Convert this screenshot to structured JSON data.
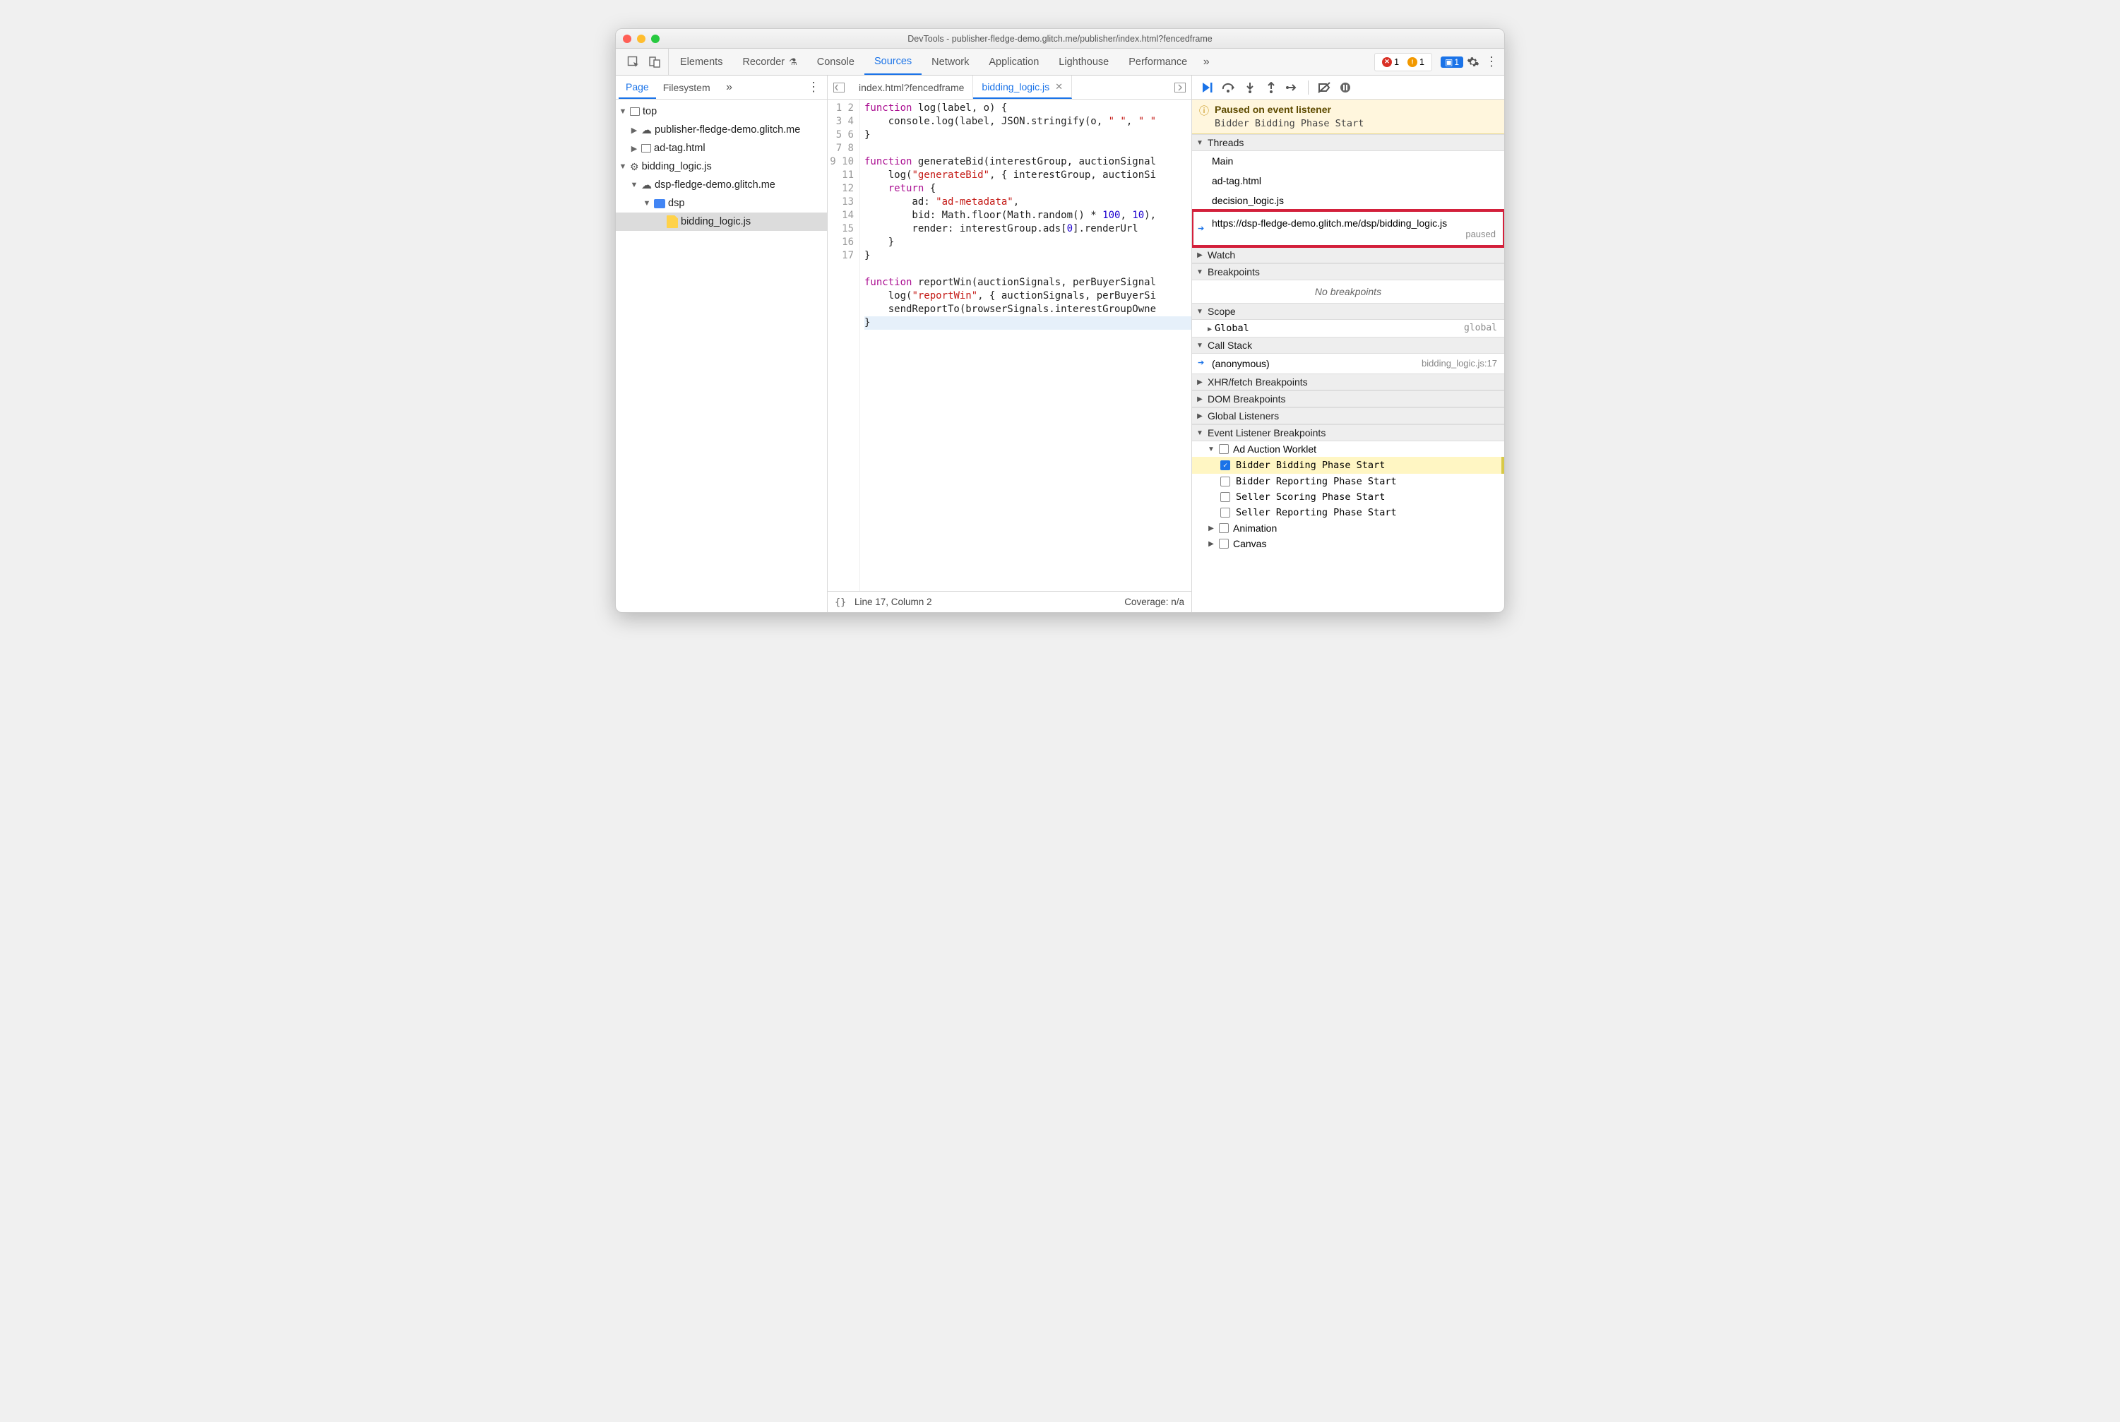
{
  "window": {
    "title": "DevTools - publisher-fledge-demo.glitch.me/publisher/index.html?fencedframe"
  },
  "topTabs": {
    "items": [
      "Elements",
      "Recorder",
      "Console",
      "Sources",
      "Network",
      "Application",
      "Lighthouse",
      "Performance"
    ],
    "active": "Sources"
  },
  "badges": {
    "errors": "1",
    "warnings": "1",
    "issues": "1"
  },
  "leftTabs": {
    "items": [
      "Page",
      "Filesystem"
    ],
    "active": "Page"
  },
  "tree": {
    "top": "top",
    "pub": "publisher-fledge-demo.glitch.me",
    "adtag": "ad-tag.html",
    "worklet": "bidding_logic.js",
    "dsphost": "dsp-fledge-demo.glitch.me",
    "dspfolder": "dsp",
    "dspfile": "bidding_logic.js"
  },
  "centerTabs": {
    "items": [
      "index.html?fencedframe",
      "bidding_logic.js"
    ],
    "active": "bidding_logic.js"
  },
  "code": {
    "lines": 17,
    "l1_a": "function",
    "l1_b": " log(label, o) {",
    "l2": "    console.log(label, JSON.stringify(o, ",
    "l2s": "\" \"",
    "l2m": ", ",
    "l2s2": "\" \"",
    "l3": "}",
    "l4": "",
    "l5_a": "function",
    "l5_b": " generateBid(interestGroup, auctionSignal",
    "l6_a": "    log(",
    "l6_s": "\"generateBid\"",
    "l6_b": ", { interestGroup, auctionSi",
    "l7_a": "    ",
    "l7_k": "return",
    "l7_b": " {",
    "l8_a": "        ad: ",
    "l8_s": "\"ad-metadata\"",
    "l8_b": ",",
    "l9_a": "        bid: Math.floor(Math.random() * ",
    "l9_n1": "100",
    "l9_m": ", ",
    "l9_n2": "10",
    "l9_b": "),",
    "l10_a": "        render: interestGroup.ads[",
    "l10_n": "0",
    "l10_b": "].renderUrl",
    "l11": "    }",
    "l12": "}",
    "l13": "",
    "l14_a": "function",
    "l14_b": " reportWin(auctionSignals, perBuyerSignal",
    "l15_a": "    log(",
    "l15_s": "\"reportWin\"",
    "l15_b": ", { auctionSignals, perBuyerSi",
    "l16": "    sendReportTo(browserSignals.interestGroupOwne",
    "l17": "}"
  },
  "statusbar": {
    "pos": "Line 17, Column 2",
    "coverage": "Coverage: n/a"
  },
  "debugger": {
    "pausedTitle": "Paused on event listener",
    "pausedSub": "Bidder Bidding Phase Start",
    "sections": {
      "threads": "Threads",
      "watch": "Watch",
      "breakpoints": "Breakpoints",
      "scope": "Scope",
      "callstack": "Call Stack",
      "xhr": "XHR/fetch Breakpoints",
      "dom": "DOM Breakpoints",
      "global": "Global Listeners",
      "elb": "Event Listener Breakpoints"
    },
    "threads": {
      "main": "Main",
      "adtag": "ad-tag.html",
      "decision": "decision_logic.js",
      "dspUrl": "https://dsp-fledge-demo.glitch.me/dsp/bidding_logic.js",
      "dspState": "paused"
    },
    "noBreakpoints": "No breakpoints",
    "scope": {
      "globalLabel": "Global",
      "globalValue": "global"
    },
    "callstack": {
      "name": "(anonymous)",
      "loc": "bidding_logic.js:17"
    },
    "elb": {
      "group": "Ad Auction Worklet",
      "items": [
        "Bidder Bidding Phase Start",
        "Bidder Reporting Phase Start",
        "Seller Scoring Phase Start",
        "Seller Reporting Phase Start"
      ],
      "animation": "Animation",
      "canvas": "Canvas"
    }
  }
}
